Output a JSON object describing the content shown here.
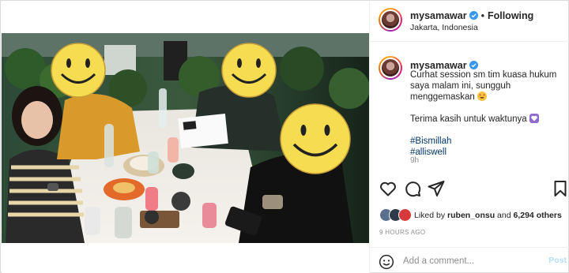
{
  "post": {
    "username": "mysamawar",
    "follow_label": "Following",
    "location": "Jakarta, Indonesia",
    "caption_line1": "Curhat session sm tim kuasa hukum saya malam ini, sungguh menggemaskan",
    "caption_line2": "Terima kasih untuk waktunya",
    "hashtags": [
      "#Bismillah",
      "#alliswell"
    ],
    "time_short": "9h",
    "liked_by_prefix": "Liked by",
    "liked_by_user": "ruben_onsu",
    "liked_by_and": "and",
    "liked_by_count": "6,294 others",
    "time_ago": "9 HOURS AGO",
    "comment_placeholder": "Add a comment...",
    "post_label": "Post"
  },
  "colors": {
    "verified": "#3897f0",
    "hashtag": "#00376b",
    "post_disabled": "#b2dffc",
    "border": "#dbdbdb",
    "face_cover": "#f5dc50"
  },
  "icons": {
    "like": "heart-icon",
    "comment": "comment-icon",
    "share": "share-icon",
    "save": "bookmark-icon",
    "emoji": "emoji-icon",
    "verified": "verified-badge-icon"
  }
}
